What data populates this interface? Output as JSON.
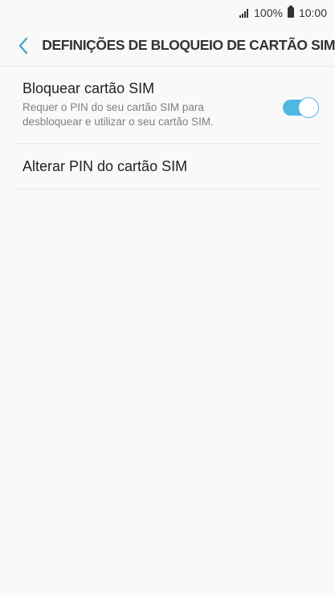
{
  "status_bar": {
    "battery_percent": "100%",
    "time": "10:00"
  },
  "header": {
    "title": "DEFINIÇÕES DE BLOQUEIO DE CARTÃO SIM",
    "back_icon": "chevron-left-icon"
  },
  "settings": {
    "lock_sim": {
      "title": "Bloquear cartão SIM",
      "description": "Requer o PIN do seu cartão SIM para desbloquear e utilizar o seu cartão SIM.",
      "enabled": true
    },
    "change_pin": {
      "title": "Alterar PIN do cartão SIM"
    }
  },
  "colors": {
    "accent": "#4fb8e3",
    "background": "#f9f9f9"
  }
}
